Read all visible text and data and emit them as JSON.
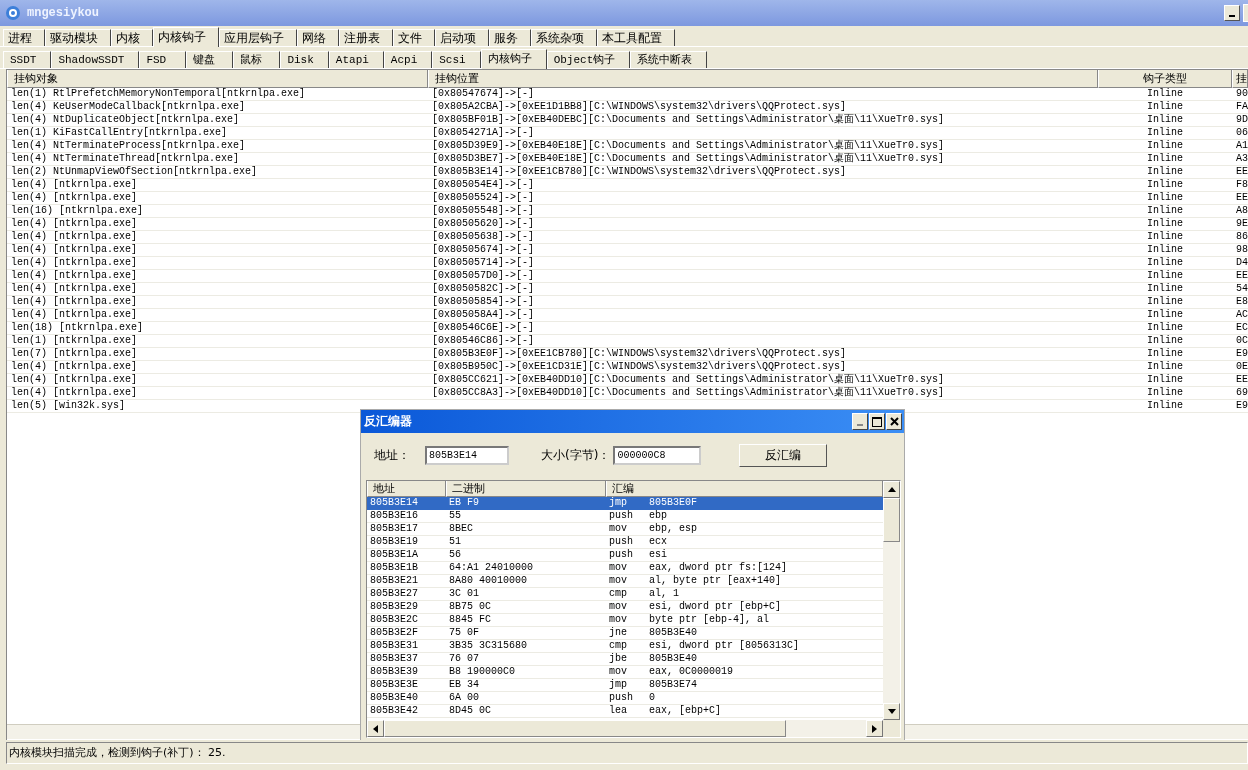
{
  "window": {
    "title": "mngesiykou"
  },
  "tabs": [
    {
      "label": "进程",
      "selected": false
    },
    {
      "label": "驱动模块",
      "selected": false
    },
    {
      "label": "内核",
      "selected": false
    },
    {
      "label": "内核钩子",
      "selected": true
    },
    {
      "label": "应用层钩子",
      "selected": false
    },
    {
      "label": "网络",
      "selected": false
    },
    {
      "label": "注册表",
      "selected": false
    },
    {
      "label": "文件",
      "selected": false
    },
    {
      "label": "启动项",
      "selected": false
    },
    {
      "label": "服务",
      "selected": false
    },
    {
      "label": "系统杂项",
      "selected": false
    },
    {
      "label": "本工具配置",
      "selected": false
    }
  ],
  "subtabs": [
    {
      "label": "SSDT",
      "selected": false
    },
    {
      "label": "ShadowSSDT",
      "selected": false
    },
    {
      "label": "FSD",
      "selected": false
    },
    {
      "label": "键盘",
      "selected": false
    },
    {
      "label": "鼠标",
      "selected": false
    },
    {
      "label": "Disk",
      "selected": false
    },
    {
      "label": "Atapi",
      "selected": false
    },
    {
      "label": "Acpi",
      "selected": false
    },
    {
      "label": "Scsi",
      "selected": false
    },
    {
      "label": "内核钩子",
      "selected": true
    },
    {
      "label": "Object钩子",
      "selected": false
    },
    {
      "label": "系统中断表",
      "selected": false
    }
  ],
  "table": {
    "columns": [
      "挂钩对象",
      "挂钩位置",
      "钩子类型",
      "挂"
    ],
    "rows": [
      {
        "object": "len(1) RtlPrefetchMemoryNonTemporal[ntkrnlpa.exe]",
        "position": "[0x80547674]->[-]",
        "hook_type": "Inline",
        "column_4": "90"
      },
      {
        "object": "len(4) KeUserModeCallback[ntkrnlpa.exe]",
        "position": "[0x805A2CBA]->[0xEE1D1BB8][C:\\WINDOWS\\system32\\drivers\\QQProtect.sys]",
        "hook_type": "Inline",
        "column_4": "FA"
      },
      {
        "object": "len(4) NtDuplicateObject[ntkrnlpa.exe]",
        "position": "[0x805BF01B]->[0xEB40DEBC][C:\\Documents and Settings\\Administrator\\桌面\\11\\XueTr0.sys]",
        "hook_type": "Inline",
        "column_4": "9D"
      },
      {
        "object": "len(1) KiFastCallEntry[ntkrnlpa.exe]",
        "position": "[0x8054271A]->[-]",
        "hook_type": "Inline",
        "column_4": "06"
      },
      {
        "object": "len(4) NtTerminateProcess[ntkrnlpa.exe]",
        "position": "[0x805D39E9]->[0xEB40E18E][C:\\Documents and Settings\\Administrator\\桌面\\11\\XueTr0.sys]",
        "hook_type": "Inline",
        "column_4": "A1"
      },
      {
        "object": "len(4) NtTerminateThread[ntkrnlpa.exe]",
        "position": "[0x805D3BE7]->[0xEB40E18E][C:\\Documents and Settings\\Administrator\\桌面\\11\\XueTr0.sys]",
        "hook_type": "Inline",
        "column_4": "A3"
      },
      {
        "object": "len(2) NtUnmapViewOfSection[ntkrnlpa.exe]",
        "position": "[0x805B3E14]->[0xEE1CB780][C:\\WINDOWS\\system32\\drivers\\QQProtect.sys]",
        "hook_type": "Inline",
        "column_4": "EE"
      },
      {
        "object": "len(4) [ntkrnlpa.exe]",
        "position": "[0x805054E4]->[-]",
        "hook_type": "Inline",
        "column_4": "F8"
      },
      {
        "object": "len(4) [ntkrnlpa.exe]",
        "position": "[0x80505524]->[-]",
        "hook_type": "Inline",
        "column_4": "EE"
      },
      {
        "object": "len(16) [ntkrnlpa.exe]",
        "position": "[0x80505548]->[-]",
        "hook_type": "Inline",
        "column_4": "A8"
      },
      {
        "object": "len(4) [ntkrnlpa.exe]",
        "position": "[0x80505620]->[-]",
        "hook_type": "Inline",
        "column_4": "9E"
      },
      {
        "object": "len(4) [ntkrnlpa.exe]",
        "position": "[0x80505638]->[-]",
        "hook_type": "Inline",
        "column_4": "86"
      },
      {
        "object": "len(4) [ntkrnlpa.exe]",
        "position": "[0x80505674]->[-]",
        "hook_type": "Inline",
        "column_4": "98"
      },
      {
        "object": "len(4) [ntkrnlpa.exe]",
        "position": "[0x80505714]->[-]",
        "hook_type": "Inline",
        "column_4": "D4"
      },
      {
        "object": "len(4) [ntkrnlpa.exe]",
        "position": "[0x805057D0]->[-]",
        "hook_type": "Inline",
        "column_4": "EE"
      },
      {
        "object": "len(4) [ntkrnlpa.exe]",
        "position": "[0x8050582C]->[-]",
        "hook_type": "Inline",
        "column_4": "54"
      },
      {
        "object": "len(4) [ntkrnlpa.exe]",
        "position": "[0x80505854]->[-]",
        "hook_type": "Inline",
        "column_4": "E8"
      },
      {
        "object": "len(4) [ntkrnlpa.exe]",
        "position": "[0x805058A4]->[-]",
        "hook_type": "Inline",
        "column_4": "AC"
      },
      {
        "object": "len(18) [ntkrnlpa.exe]",
        "position": "[0x80546C6E]->[-]",
        "hook_type": "Inline",
        "column_4": "EC"
      },
      {
        "object": "len(1) [ntkrnlpa.exe]",
        "position": "[0x80546C86]->[-]",
        "hook_type": "Inline",
        "column_4": "0C"
      },
      {
        "object": "len(7) [ntkrnlpa.exe]",
        "position": "[0x805B3E0F]->[0xEE1CB780][C:\\WINDOWS\\system32\\drivers\\QQProtect.sys]",
        "hook_type": "Inline",
        "column_4": "E9"
      },
      {
        "object": "len(4) [ntkrnlpa.exe]",
        "position": "[0x805B950C]->[0xEE1CD31E][C:\\WINDOWS\\system32\\drivers\\QQProtect.sys]",
        "hook_type": "Inline",
        "column_4": "0E"
      },
      {
        "object": "len(4) [ntkrnlpa.exe]",
        "position": "[0x805CC621]->[0xEB40DD10][C:\\Documents and Settings\\Administrator\\桌面\\11\\XueTr0.sys]",
        "hook_type": "Inline",
        "column_4": "EE"
      },
      {
        "object": "len(4) [ntkrnlpa.exe]",
        "position": "[0x805CC8A3]->[0xEB40DD10][C:\\Documents and Settings\\Administrator\\桌面\\11\\XueTr0.sys]",
        "hook_type": "Inline",
        "column_4": "69"
      },
      {
        "object": "len(5) [win32k.sys]",
        "hook_type": "Inline",
        "column_4": "E9"
      }
    ]
  },
  "dialog": {
    "title": "反汇编器",
    "address_label": "地址：",
    "address": "805B3E14",
    "size_label": "大小(字节)：",
    "size": "000000C8",
    "button": "反汇编",
    "columns": [
      "地址",
      "二进制",
      "汇编"
    ],
    "rows": [
      {
        "address": "805B3E14",
        "binary": "EB F9",
        "mnemonic": "jmp",
        "operands": "805B3E0F",
        "selected": true
      },
      {
        "address": "805B3E16",
        "binary": "55",
        "mnemonic": "push",
        "operands": "ebp",
        "selected": false
      },
      {
        "address": "805B3E17",
        "binary": "8BEC",
        "mnemonic": "mov",
        "operands": "ebp, esp",
        "selected": false
      },
      {
        "address": "805B3E19",
        "binary": "51",
        "mnemonic": "push",
        "operands": "ecx",
        "selected": false
      },
      {
        "address": "805B3E1A",
        "binary": "56",
        "mnemonic": "push",
        "operands": "esi",
        "selected": false
      },
      {
        "address": "805B3E1B",
        "binary": "64:A1 24010000",
        "mnemonic": "mov",
        "operands": "eax, dword ptr fs:[124]",
        "selected": false
      },
      {
        "address": "805B3E21",
        "binary": "8A80 40010000",
        "mnemonic": "mov",
        "operands": "al, byte ptr [eax+140]",
        "selected": false
      },
      {
        "address": "805B3E27",
        "binary": "3C 01",
        "mnemonic": "cmp",
        "operands": "al, 1",
        "selected": false
      },
      {
        "address": "805B3E29",
        "binary": "8B75 0C",
        "mnemonic": "mov",
        "operands": "esi, dword ptr [ebp+C]",
        "selected": false
      },
      {
        "address": "805B3E2C",
        "binary": "8845 FC",
        "mnemonic": "mov",
        "operands": "byte ptr [ebp-4], al",
        "selected": false
      },
      {
        "address": "805B3E2F",
        "binary": "75 0F",
        "mnemonic": "jne",
        "operands": "805B3E40",
        "selected": false
      },
      {
        "address": "805B3E31",
        "binary": "3B35 3C315680",
        "mnemonic": "cmp",
        "operands": "esi, dword ptr [8056313C]",
        "selected": false
      },
      {
        "address": "805B3E37",
        "binary": "76 07",
        "mnemonic": "jbe",
        "operands": "805B3E40",
        "selected": false
      },
      {
        "address": "805B3E39",
        "binary": "B8 190000C0",
        "mnemonic": "mov",
        "operands": "eax, 0C0000019",
        "selected": false
      },
      {
        "address": "805B3E3E",
        "binary": "EB 34",
        "mnemonic": "jmp",
        "operands": "805B3E74",
        "selected": false
      },
      {
        "address": "805B3E40",
        "binary": "6A 00",
        "mnemonic": "push",
        "operands": "0",
        "selected": false
      },
      {
        "address": "805B3E42",
        "binary": "8D45 0C",
        "mnemonic": "lea",
        "operands": "eax, [ebp+C]",
        "selected": false
      }
    ]
  },
  "status_bar": "内核模块扫描完成，检测到钩子(补丁)： 25."
}
